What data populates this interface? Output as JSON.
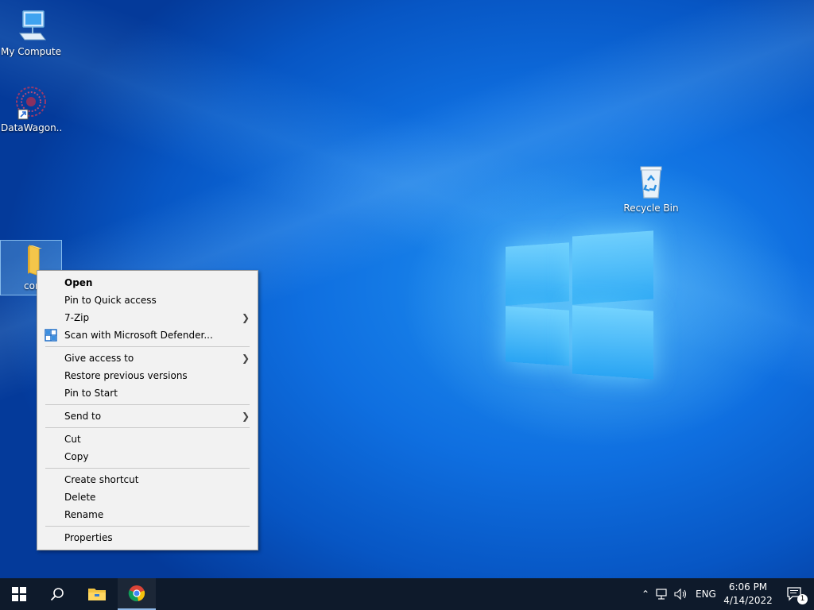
{
  "desktop": {
    "icons": [
      {
        "label": "My Computer",
        "icon": "computer-icon"
      },
      {
        "label": "DataWagon...",
        "icon": "datawagon-app-icon"
      },
      {
        "label": "Recycle Bin",
        "icon": "recycle-bin-icon"
      },
      {
        "label": "cor",
        "icon": "folder-icon"
      }
    ]
  },
  "context_menu": {
    "items": [
      {
        "label": "Open"
      },
      {
        "label": "Pin to Quick access"
      },
      {
        "label": "7-Zip"
      },
      {
        "label": "Scan with Microsoft Defender..."
      },
      {
        "label": "Give access to"
      },
      {
        "label": "Restore previous versions"
      },
      {
        "label": "Pin to Start"
      },
      {
        "label": "Send to"
      },
      {
        "label": "Cut"
      },
      {
        "label": "Copy"
      },
      {
        "label": "Create shortcut"
      },
      {
        "label": "Delete"
      },
      {
        "label": "Rename"
      },
      {
        "label": "Properties"
      }
    ]
  },
  "taskbar": {
    "start_icon": "windows-start-icon",
    "search_icon": "search-icon",
    "pinned": [
      "file-explorer-icon",
      "chrome-icon"
    ],
    "tray": {
      "language": "ENG",
      "time": "6:06 PM",
      "date": "4/14/2022",
      "notification_count": "1"
    }
  },
  "colors": {
    "taskbar": "#0e1a2b",
    "menu_bg": "#f2f2f2",
    "desktop_accent": "#0f6fe0"
  }
}
